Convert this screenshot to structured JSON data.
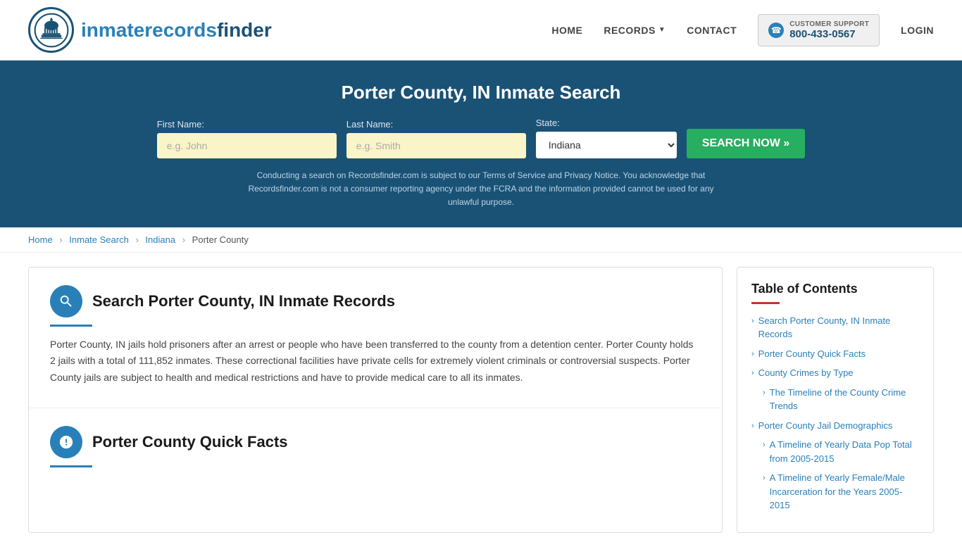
{
  "header": {
    "logo_text_part1": "inmaterecords",
    "logo_text_part2": "finder",
    "nav": {
      "home": "HOME",
      "records": "RECORDS",
      "contact": "CONTACT",
      "login": "LOGIN"
    },
    "support": {
      "label": "CUSTOMER SUPPORT",
      "phone": "800-433-0567"
    }
  },
  "hero": {
    "title": "Porter County, IN Inmate Search",
    "form": {
      "first_name_label": "First Name:",
      "first_name_placeholder": "e.g. John",
      "last_name_label": "Last Name:",
      "last_name_placeholder": "e.g. Smith",
      "state_label": "State:",
      "state_value": "Indiana",
      "search_button": "SEARCH NOW »"
    },
    "disclaimer": "Conducting a search on Recordsfinder.com is subject to our Terms of Service and Privacy Notice. You acknowledge that Recordsfinder.com is not a consumer reporting agency under the FCRA and the information provided cannot be used for any unlawful purpose."
  },
  "breadcrumb": {
    "home": "Home",
    "inmate_search": "Inmate Search",
    "indiana": "Indiana",
    "current": "Porter County"
  },
  "article": {
    "section1": {
      "title": "Search Porter County, IN Inmate Records",
      "text": "Porter County, IN jails hold prisoners after an arrest or people who have been transferred to the county from a detention center. Porter County holds 2 jails with a total of 111,852 inmates. These correctional facilities have private cells for extremely violent criminals or controversial suspects. Porter County jails are subject to health and medical restrictions and have to provide medical care to all its inmates."
    },
    "section2": {
      "title": "Porter County Quick Facts"
    }
  },
  "toc": {
    "title": "Table of Contents",
    "items": [
      {
        "label": "Search Porter County, IN Inmate Records",
        "sub": false
      },
      {
        "label": "Porter County Quick Facts",
        "sub": false
      },
      {
        "label": "County Crimes by Type",
        "sub": false
      },
      {
        "label": "The Timeline of the County Crime Trends",
        "sub": true
      },
      {
        "label": "Porter County Jail Demographics",
        "sub": false
      },
      {
        "label": "A Timeline of Yearly Data Pop Total from 2005-2015",
        "sub": true
      },
      {
        "label": "A Timeline of Yearly Female/Male Incarceration for the Years 2005-2015",
        "sub": true
      }
    ]
  }
}
